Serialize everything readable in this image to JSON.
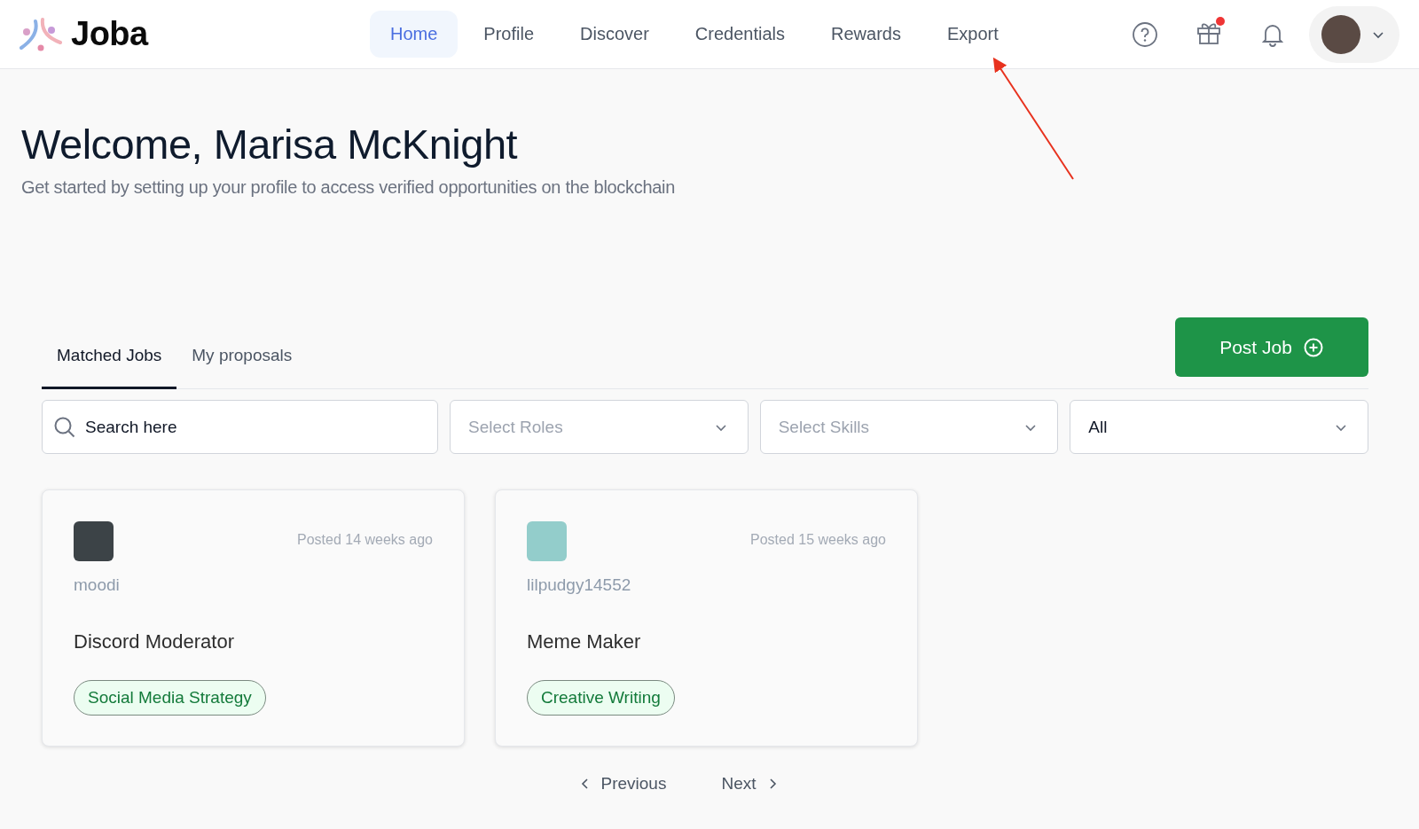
{
  "brand": "Joba",
  "nav": [
    {
      "label": "Home",
      "selected": true
    },
    {
      "label": "Profile",
      "selected": false
    },
    {
      "label": "Discover",
      "selected": false
    },
    {
      "label": "Credentials",
      "selected": false
    },
    {
      "label": "Rewards",
      "selected": false
    },
    {
      "label": "Export",
      "selected": false
    }
  ],
  "gift_unread": true,
  "title": "Welcome, Marisa McKnight",
  "subtitle": "Get started by setting up your profile to access verified opportunities on the blockchain",
  "tabs": [
    {
      "label": "Matched Jobs",
      "selected": true
    },
    {
      "label": "My proposals",
      "selected": false
    }
  ],
  "post_button": "Post Job",
  "filters": [
    {
      "kind": "search",
      "placeholder": "Search here"
    },
    {
      "kind": "select",
      "placeholder": "Select Roles"
    },
    {
      "kind": "select",
      "placeholder": "Select Skills"
    },
    {
      "kind": "select",
      "value": "All"
    }
  ],
  "jobs": [
    {
      "color": "#3c4347",
      "poster": "moodi",
      "posted": "Posted 14 weeks ago",
      "title": "Discord Moderator",
      "tags": [
        "Social Media Strategy"
      ]
    },
    {
      "color": "#93cdcb",
      "poster": "lilpudgy14552",
      "posted": "Posted 15 weeks ago",
      "title": "Meme Maker",
      "tags": [
        "Creative Writing"
      ]
    }
  ],
  "pagination": {
    "previous": "Previous",
    "next": "Next"
  }
}
